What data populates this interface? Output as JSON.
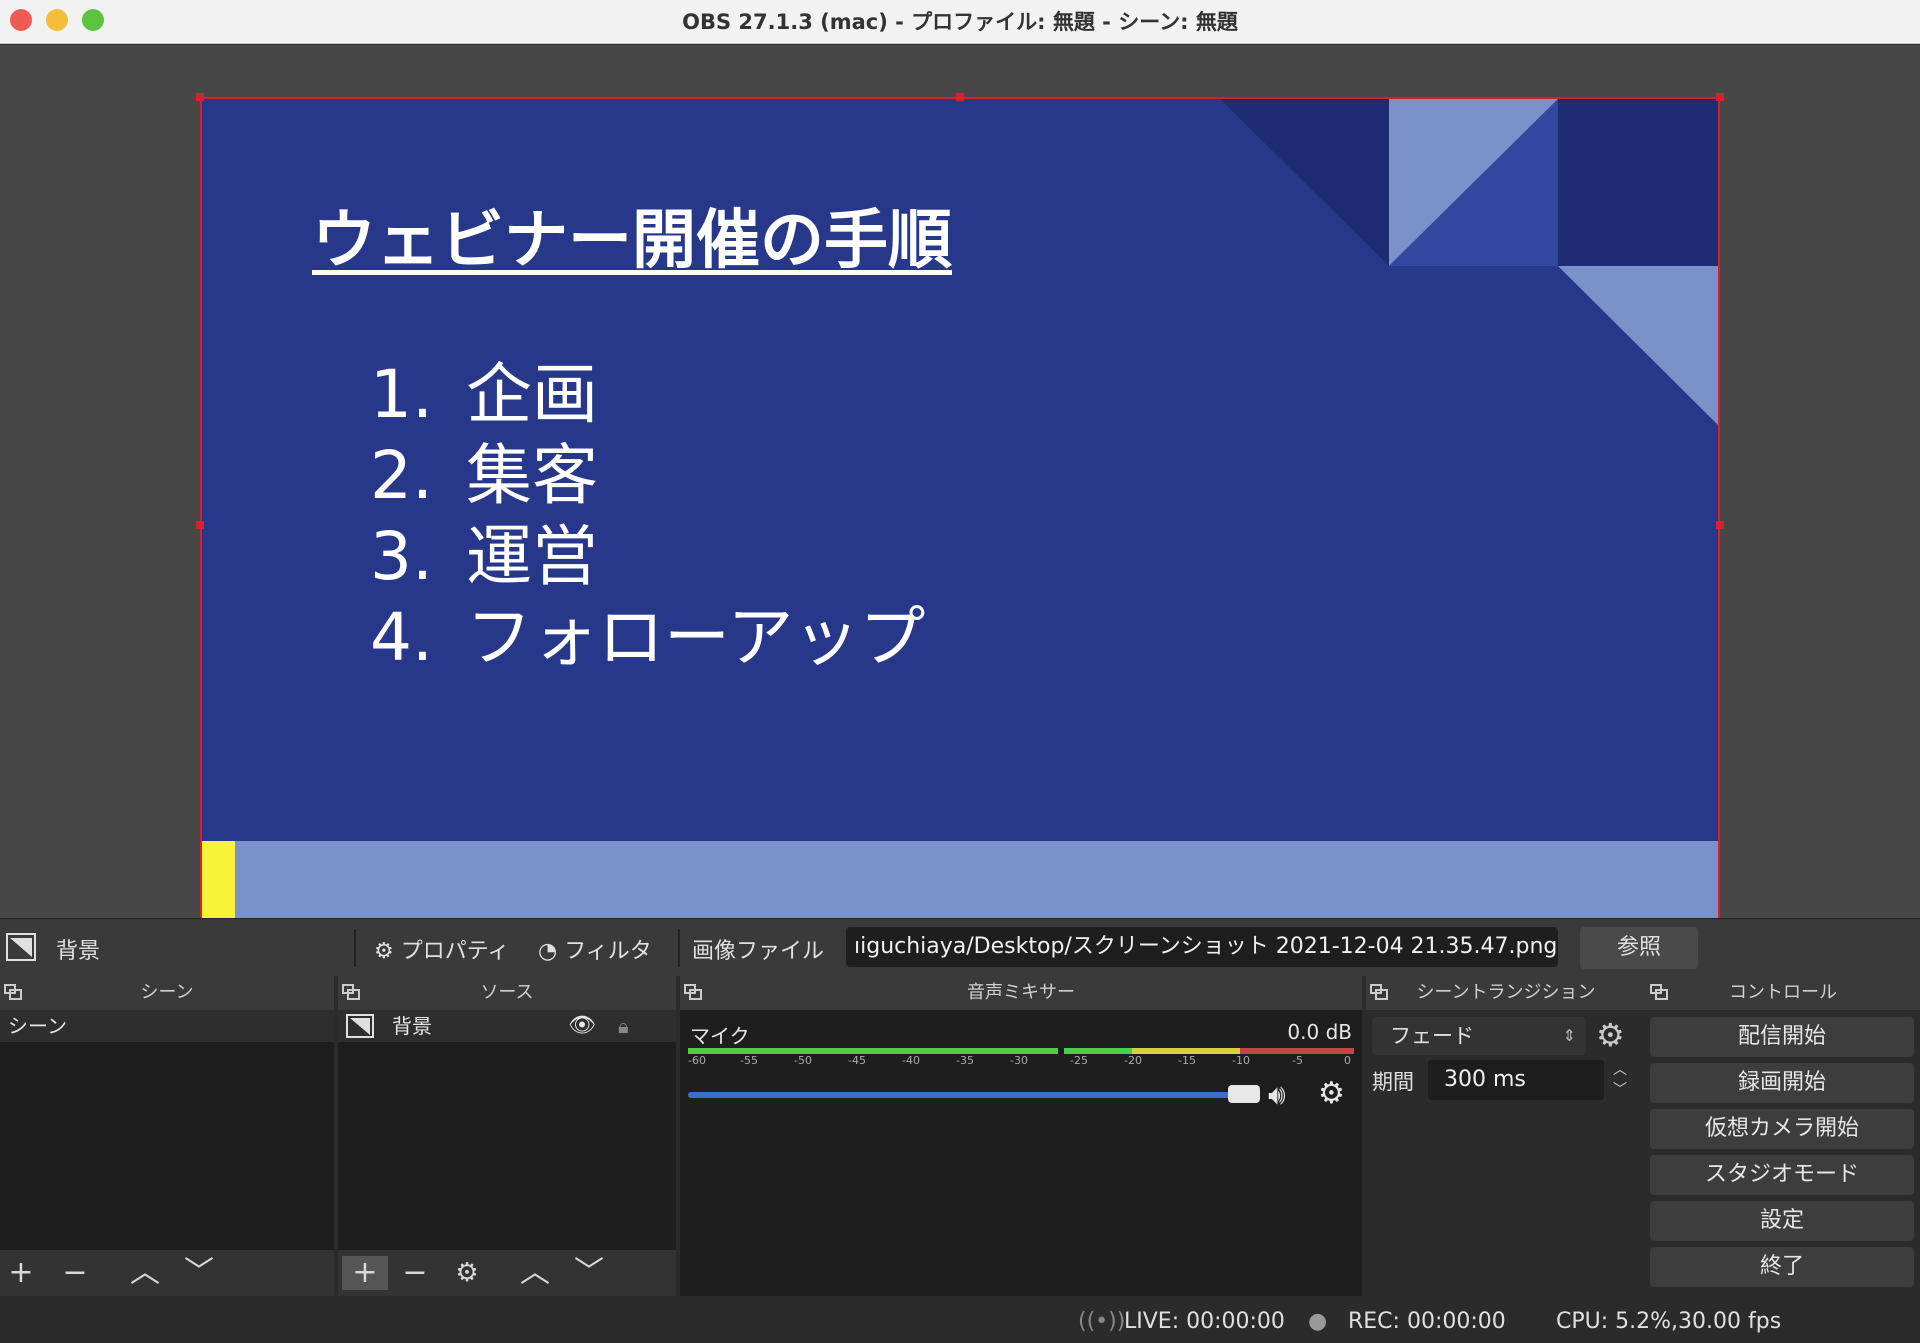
{
  "window": {
    "title": "OBS 27.1.3 (mac) - プロファイル: 無題 - シーン: 無題"
  },
  "preview": {
    "slide_title": "ウェビナー開催の手順",
    "list": [
      {
        "num": "1.",
        "text": "企画"
      },
      {
        "num": "2.",
        "text": "集客"
      },
      {
        "num": "3.",
        "text": "運営"
      },
      {
        "num": "4.",
        "text": "フォローアップ"
      }
    ],
    "colors": {
      "background": "#27388b",
      "footer": "#7b91ca",
      "accent": "#f7f33b",
      "selection": "#d8202a"
    }
  },
  "source_toolbar": {
    "source_name": "背景",
    "properties_label": "プロパティ",
    "filters_label": "フィルタ",
    "image_file_label": "画像ファイル",
    "path_value": "ıiguchiaya/Desktop/スクリーンショット 2021-12-04 21.35.47.png",
    "browse_label": "参照"
  },
  "docks": {
    "scenes": {
      "header": "シーン",
      "items": [
        "シーン"
      ]
    },
    "sources": {
      "header": "ソース",
      "items": [
        "背景"
      ]
    },
    "mixer": {
      "header": "音声ミキサー",
      "channel_name": "マイク",
      "level": "0.0 dB",
      "scale": [
        "-60",
        "-55",
        "-50",
        "-45",
        "-40",
        "-35",
        "-30",
        "-25",
        "-20",
        "-15",
        "-10",
        "-5",
        "0"
      ],
      "volume_fraction": 1.0
    },
    "transitions": {
      "header": "シーントランジション",
      "selected": "フェード",
      "duration_label": "期間",
      "duration_value": "300 ms"
    },
    "controls": {
      "header": "コントロール",
      "buttons": [
        "配信開始",
        "録画開始",
        "仮想カメラ開始",
        "スタジオモード",
        "設定",
        "終了"
      ]
    }
  },
  "status": {
    "live": "LIVE: 00:00:00",
    "rec": "REC: 00:00:00",
    "cpu": "CPU: 5.2%,30.00 fps"
  }
}
